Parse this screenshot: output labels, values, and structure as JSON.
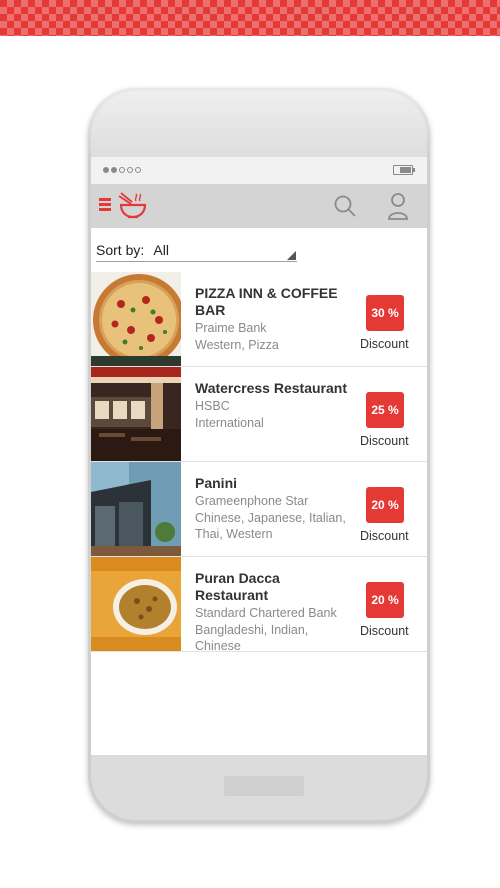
{
  "app": {
    "sort": {
      "label": "Sort by:",
      "value": "All"
    },
    "restaurants": [
      {
        "name": "PIZZA INN & COFFEE BAR",
        "bank": "Praime Bank",
        "cuisine": "Western, Pizza",
        "discount": "30 %",
        "discount_label": "Discount"
      },
      {
        "name": "Watercress Restaurant",
        "bank": "HSBC",
        "cuisine": "International",
        "discount": "25 %",
        "discount_label": "Discount"
      },
      {
        "name": "Panini",
        "bank": "Grameenphone Star",
        "cuisine": "Chinese, Japanese, Italian, Thai, Western",
        "discount": "20 %",
        "discount_label": "Discount"
      },
      {
        "name": "Puran Dacca Restaurant",
        "bank": "Standard Chartered Bank",
        "cuisine": "Bangladeshi, Indian, Chinese",
        "discount": "20 %",
        "discount_label": "Discount"
      }
    ]
  },
  "icons": {
    "menu": "menu-icon",
    "logo": "food-bowl-logo-icon",
    "search": "search-icon",
    "user": "user-icon"
  },
  "colors": {
    "accent": "#e53935",
    "header": "#d4d4d4"
  }
}
